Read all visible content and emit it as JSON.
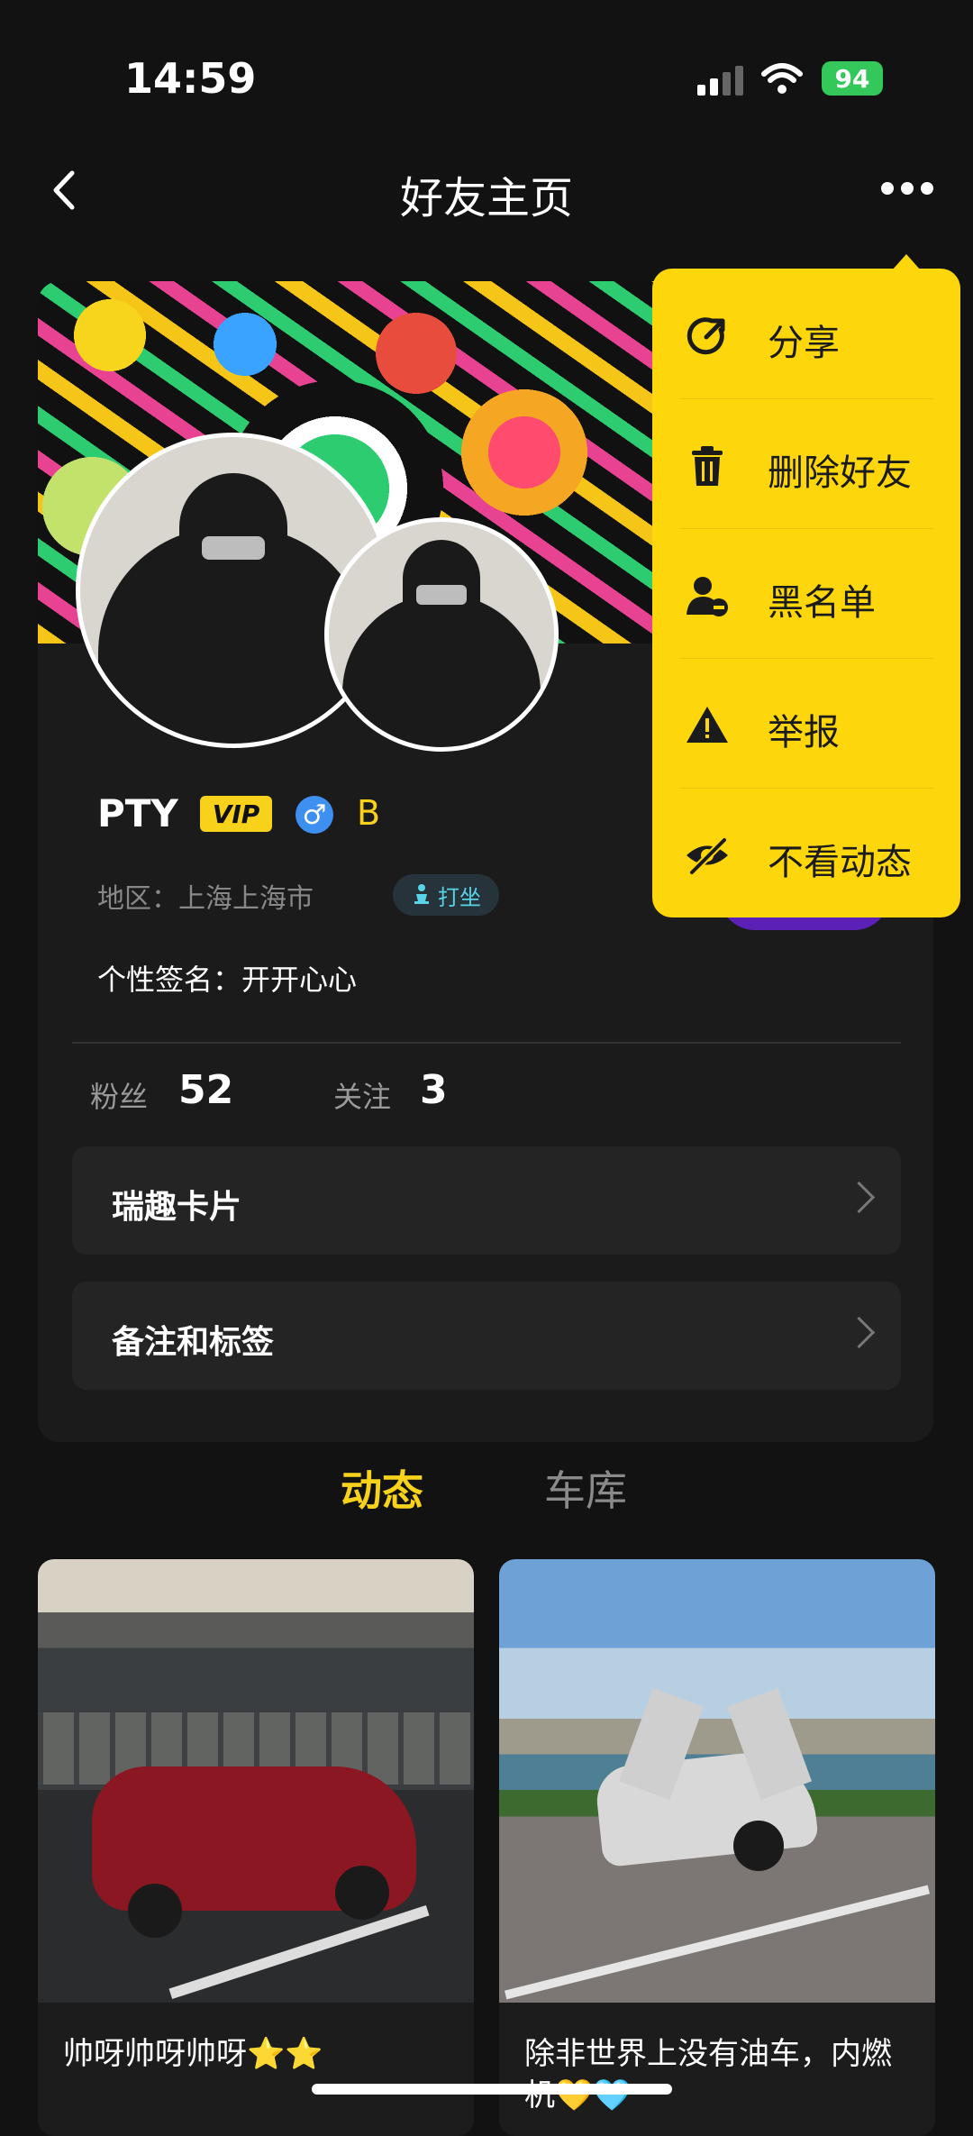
{
  "status_bar": {
    "time": "14:59",
    "battery": "94"
  },
  "header": {
    "title": "好友主页"
  },
  "profile": {
    "nickname": "PTY",
    "vip_badge": "VIP",
    "gender_symbol": "♂",
    "grade": "B",
    "region": "地区：上海上海市",
    "status_tag": "打坐",
    "signature": "个性签名：开开心心",
    "stats": [
      {
        "label": "粉丝",
        "value": "52"
      },
      {
        "label": "关注",
        "value": "3"
      }
    ],
    "rows": [
      {
        "label": "瑞趣卡片"
      },
      {
        "label": "备注和标签"
      }
    ]
  },
  "tabs": [
    {
      "label": "动态",
      "active": true
    },
    {
      "label": "车库",
      "active": false
    }
  ],
  "posts": [
    {
      "caption": "帅呀帅呀帅呀⭐⭐"
    },
    {
      "caption": "除非世界上没有油车，内燃机💛🩵"
    }
  ],
  "menu": {
    "items": [
      {
        "label": "分享",
        "icon": "share-icon"
      },
      {
        "label": "删除好友",
        "icon": "trash-icon"
      },
      {
        "label": "黑名单",
        "icon": "block-user-icon"
      },
      {
        "label": "举报",
        "icon": "warning-icon"
      },
      {
        "label": "不看动态",
        "icon": "eye-off-icon"
      }
    ]
  },
  "colors": {
    "accent": "#fdd60c",
    "background": "#121212",
    "card": "#1b1b1b"
  }
}
